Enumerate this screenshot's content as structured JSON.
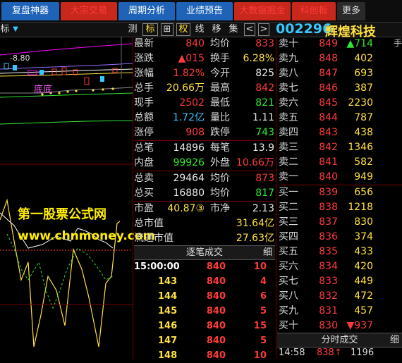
{
  "tabs": [
    {
      "label": "复盘神器",
      "color": "blue"
    },
    {
      "label": "大宗交易",
      "color": "red"
    },
    {
      "label": "周期分析",
      "color": "blue"
    },
    {
      "label": "业绩预告",
      "color": "blue"
    },
    {
      "label": "大数据掘金",
      "color": "red"
    },
    {
      "label": "科创板",
      "color": "red"
    },
    {
      "label": "更多",
      "color": "dark"
    }
  ],
  "toolbar": {
    "left_label": "标",
    "left_arrow": "▼",
    "items": [
      "测",
      "标",
      "⊞",
      "权",
      "线",
      "移",
      "集"
    ],
    "nav_left": "<",
    "nav_right": ">"
  },
  "stock": {
    "code": "002296",
    "name": "辉煌科技"
  },
  "chart_labels": {
    "price_marker": "-8.80",
    "label_bottom": "底底"
  },
  "watermark": {
    "line1": "第一股票公式网",
    "line2": "www.chnmoney.com"
  },
  "quote": {
    "latest": {
      "label": "最新",
      "value": "840"
    },
    "avg": {
      "label": "均价",
      "value": "833"
    },
    "change": {
      "label": "涨跌",
      "value": "▲015"
    },
    "turnover": {
      "label": "换手",
      "value": "6.28%"
    },
    "pct": {
      "label": "涨幅",
      "value": "1.82%"
    },
    "open": {
      "label": "今开",
      "value": "825"
    },
    "total_hands": {
      "label": "总手",
      "value": "20.66万"
    },
    "high": {
      "label": "最高",
      "value": "842"
    },
    "current_hands": {
      "label": "现手",
      "value": "2502"
    },
    "low": {
      "label": "最低",
      "value": "821"
    },
    "amount": {
      "label": "总额",
      "value": "1.72亿"
    },
    "vol_ratio": {
      "label": "量比",
      "value": "1.11"
    },
    "limit_up": {
      "label": "涨停",
      "value": "908"
    },
    "limit_down": {
      "label": "跌停",
      "value": "743"
    },
    "trades": {
      "label": "总笔",
      "value": "14896"
    },
    "per_trade": {
      "label": "每笔",
      "value": "13.9"
    },
    "inner": {
      "label": "内盘",
      "value": "99926"
    },
    "outer": {
      "label": "外盘",
      "value": "10.66万"
    },
    "total_sell": {
      "label": "总卖",
      "value": "29464"
    },
    "sell_avg": {
      "label": "均价",
      "value": "873"
    },
    "total_buy": {
      "label": "总买",
      "value": "16880"
    },
    "buy_avg": {
      "label": "均价",
      "value": "817"
    },
    "pe": {
      "label": "市盈",
      "value": "40.87③"
    },
    "pb": {
      "label": "市净",
      "value": "2.13"
    },
    "market_cap": {
      "label": "总市值",
      "value": "31.64亿"
    },
    "float_cap": {
      "label": "流通市值",
      "value": "27.63亿"
    }
  },
  "sell_orders": [
    {
      "label": "卖十",
      "price": "849",
      "vol": "▲714"
    },
    {
      "label": "卖九",
      "price": "848",
      "vol": "402"
    },
    {
      "label": "卖八",
      "price": "847",
      "vol": "693"
    },
    {
      "label": "卖七",
      "price": "846",
      "vol": "387"
    },
    {
      "label": "卖六",
      "price": "845",
      "vol": "2230"
    },
    {
      "label": "卖五",
      "price": "844",
      "vol": "787"
    },
    {
      "label": "卖四",
      "price": "843",
      "vol": "438"
    },
    {
      "label": "卖三",
      "price": "842",
      "vol": "1346"
    },
    {
      "label": "卖二",
      "price": "841",
      "vol": "582"
    },
    {
      "label": "卖一",
      "price": "840",
      "vol": "949"
    }
  ],
  "buy_orders": [
    {
      "label": "买一",
      "price": "839",
      "vol": "656"
    },
    {
      "label": "买二",
      "price": "838",
      "vol": "1218"
    },
    {
      "label": "买三",
      "price": "837",
      "vol": "830"
    },
    {
      "label": "买四",
      "price": "836",
      "vol": "374"
    },
    {
      "label": "买五",
      "price": "835",
      "vol": "433"
    },
    {
      "label": "买六",
      "price": "834",
      "vol": "420"
    },
    {
      "label": "买七",
      "price": "833",
      "vol": "449"
    },
    {
      "label": "买八",
      "price": "832",
      "vol": "472"
    },
    {
      "label": "买九",
      "price": "831",
      "vol": "457"
    },
    {
      "label": "买十",
      "price": "830",
      "vol": "▼937"
    }
  ],
  "side_label": "手",
  "ticks_header": {
    "title": "逐笔成交",
    "detail": "细"
  },
  "ticks": [
    {
      "time": "15:00:00",
      "price": "840",
      "vol": "10"
    },
    {
      "time": "143",
      "price": "840",
      "vol": "4"
    },
    {
      "time": "144",
      "price": "840",
      "vol": "6"
    },
    {
      "time": "145",
      "price": "840",
      "vol": "5"
    },
    {
      "time": "146",
      "price": "840",
      "vol": "15"
    },
    {
      "time": "147",
      "price": "840",
      "vol": "5"
    },
    {
      "time": "148",
      "price": "840",
      "vol": "10"
    }
  ],
  "fen_header": {
    "title": "分时成交",
    "detail": "细"
  },
  "fen_row": {
    "time": "14:58",
    "price": "838↑",
    "vol": "1196"
  }
}
